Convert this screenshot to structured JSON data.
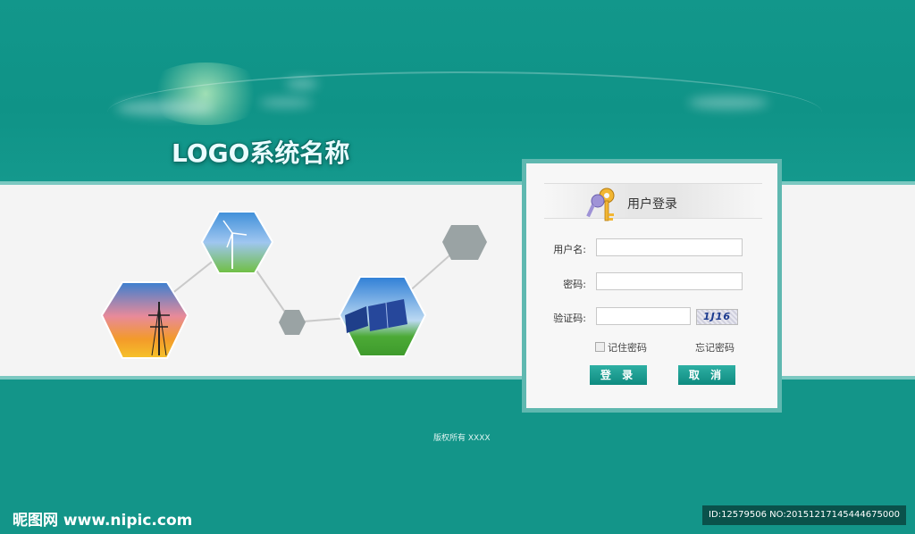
{
  "header": {
    "logo_text": "LOGO系统名称"
  },
  "login": {
    "title": "用户登录",
    "username_label": "用户名:",
    "password_label": "密码:",
    "captcha_label": "验证码:",
    "username_value": "",
    "password_value": "",
    "captcha_value": "",
    "captcha_image_text": "1J16",
    "remember_label": "记住密码",
    "forgot_label": "忘记密码",
    "login_button": "登 录",
    "cancel_button": "取 消"
  },
  "footer": {
    "copyright": "版权所有 XXXX"
  },
  "watermark": {
    "left": "昵图网 www.nipic.com",
    "right": "ID:12579506 NO:20151217145444675000"
  },
  "colors": {
    "teal": "#12968a",
    "band": "#f4f4f4",
    "border": "#5fb8b0"
  }
}
